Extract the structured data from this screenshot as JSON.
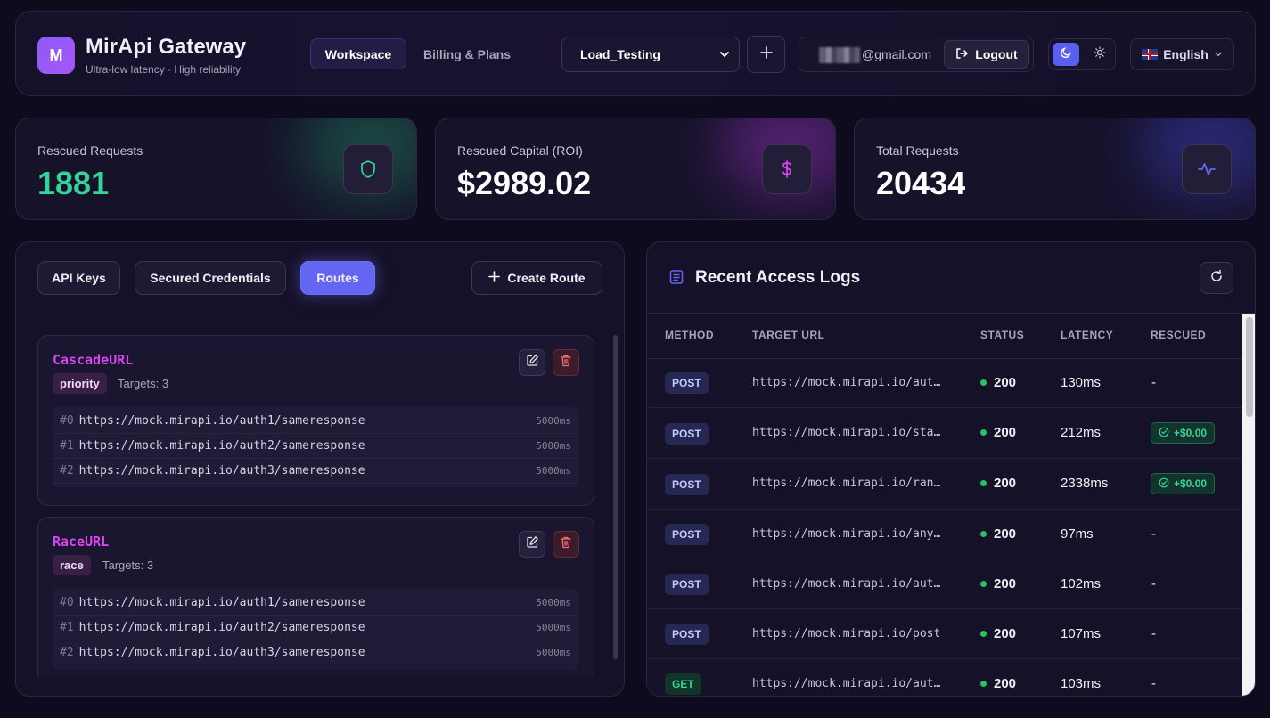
{
  "brand": {
    "logo_letter": "M",
    "title": "MirApi Gateway",
    "subtitle": "Ultra-low latency · High reliability"
  },
  "nav": {
    "workspace": "Workspace",
    "billing": "Billing & Plans"
  },
  "project_select": {
    "value": "Load_Testing"
  },
  "user": {
    "email": "@gmail.com",
    "logout": "Logout"
  },
  "language": {
    "value": "English"
  },
  "colors": {
    "accent": "#6366f1",
    "route_name": "#d946ef",
    "success": "#34d399",
    "rescued_requests": "#34d399"
  },
  "stats": [
    {
      "label": "Rescued Requests",
      "value": "1881",
      "icon": "shield-icon"
    },
    {
      "label": "Rescued Capital (ROI)",
      "value": "$2989.02",
      "icon": "dollar-icon"
    },
    {
      "label": "Total Requests",
      "value": "20434",
      "icon": "activity-icon"
    }
  ],
  "tabs": {
    "api_keys": "API Keys",
    "secured_credentials": "Secured Credentials",
    "routes": "Routes",
    "create_route": "Create Route"
  },
  "routes": [
    {
      "name": "CascadeURL",
      "strategy": "priority",
      "targets_label": "Targets: 3",
      "targets": [
        {
          "idx": "#0",
          "url": "https://mock.mirapi.io/auth1/sameresponse",
          "timeout": "5000ms"
        },
        {
          "idx": "#1",
          "url": "https://mock.mirapi.io/auth2/sameresponse",
          "timeout": "5000ms"
        },
        {
          "idx": "#2",
          "url": "https://mock.mirapi.io/auth3/sameresponse",
          "timeout": "5000ms"
        }
      ]
    },
    {
      "name": "RaceURL",
      "strategy": "race",
      "targets_label": "Targets: 3",
      "targets": [
        {
          "idx": "#0",
          "url": "https://mock.mirapi.io/auth1/sameresponse",
          "timeout": "5000ms"
        },
        {
          "idx": "#1",
          "url": "https://mock.mirapi.io/auth2/sameresponse",
          "timeout": "5000ms"
        },
        {
          "idx": "#2",
          "url": "https://mock.mirapi.io/auth3/sameresponse",
          "timeout": "5000ms"
        }
      ]
    }
  ],
  "logs": {
    "title": "Recent Access Logs",
    "columns": [
      "METHOD",
      "TARGET URL",
      "STATUS",
      "LATENCY",
      "RESCUED"
    ],
    "rows": [
      {
        "method": "POST",
        "url": "https://mock.mirapi.io/aut…",
        "status": "200",
        "latency": "130ms",
        "rescued": "-"
      },
      {
        "method": "POST",
        "url": "https://mock.mirapi.io/sta…",
        "status": "200",
        "latency": "212ms",
        "rescued": "+$0.00"
      },
      {
        "method": "POST",
        "url": "https://mock.mirapi.io/ran…",
        "status": "200",
        "latency": "2338ms",
        "rescued": "+$0.00"
      },
      {
        "method": "POST",
        "url": "https://mock.mirapi.io/any…",
        "status": "200",
        "latency": "97ms",
        "rescued": "-"
      },
      {
        "method": "POST",
        "url": "https://mock.mirapi.io/aut…",
        "status": "200",
        "latency": "102ms",
        "rescued": "-"
      },
      {
        "method": "POST",
        "url": "https://mock.mirapi.io/post",
        "status": "200",
        "latency": "107ms",
        "rescued": "-"
      },
      {
        "method": "GET",
        "url": "https://mock.mirapi.io/aut…",
        "status": "200",
        "latency": "103ms",
        "rescued": "-"
      }
    ]
  }
}
